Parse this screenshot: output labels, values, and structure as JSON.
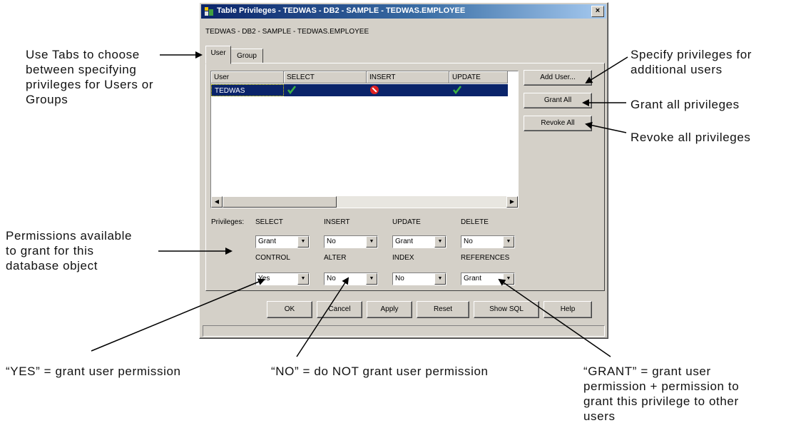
{
  "dialog": {
    "title": "Table Privileges - TEDWAS - DB2 - SAMPLE - TEDWAS.EMPLOYEE",
    "subtitle": "TEDWAS - DB2 - SAMPLE - TEDWAS.EMPLOYEE",
    "close_glyph": "×",
    "tabs": [
      "User",
      "Group"
    ],
    "grid": {
      "columns": [
        "User",
        "SELECT",
        "INSERT",
        "UPDATE"
      ],
      "rows": [
        {
          "user": "TEDWAS",
          "select": "check",
          "insert": "deny",
          "update": "check"
        }
      ]
    },
    "side_buttons": [
      "Add User...",
      "Grant All",
      "Revoke All"
    ],
    "privileges_label": "Privileges:",
    "privileges": [
      {
        "name": "SELECT",
        "value": "Grant"
      },
      {
        "name": "INSERT",
        "value": "No"
      },
      {
        "name": "UPDATE",
        "value": "Grant"
      },
      {
        "name": "DELETE",
        "value": "No"
      },
      {
        "name": "CONTROL",
        "value": "Yes"
      },
      {
        "name": "ALTER",
        "value": "No"
      },
      {
        "name": "INDEX",
        "value": "No"
      },
      {
        "name": "REFERENCES",
        "value": "Grant"
      }
    ],
    "bottom_buttons": [
      "OK",
      "Cancel",
      "Apply",
      "Reset",
      "Show SQL",
      "Help"
    ]
  },
  "annotations": {
    "tabs_note": "Use Tabs to choose\nbetween specifying\nprivileges for Users or\nGroups",
    "add_user_note": "Specify privileges for\nadditional users",
    "grant_all_note": "Grant all privileges",
    "revoke_all_note": "Revoke all privileges",
    "permissions_note": "Permissions available\nto grant for this\ndatabase object",
    "yes_note": "“YES” = grant user permission",
    "no_note": "“NO” = do NOT grant user permission",
    "grant_note": "“GRANT” = grant user\npermission + permission to\ngrant this privilege to other\nusers"
  },
  "colors": {
    "window_face": "#d4d0c8",
    "titlebar_start": "#0a246a",
    "selected_row": "#0a246a",
    "check": "#3cb043",
    "deny": "#e02020"
  },
  "icons": {
    "app": "database-table-icon",
    "granted": "green-check-icon",
    "denied": "red-no-entry-icon"
  }
}
